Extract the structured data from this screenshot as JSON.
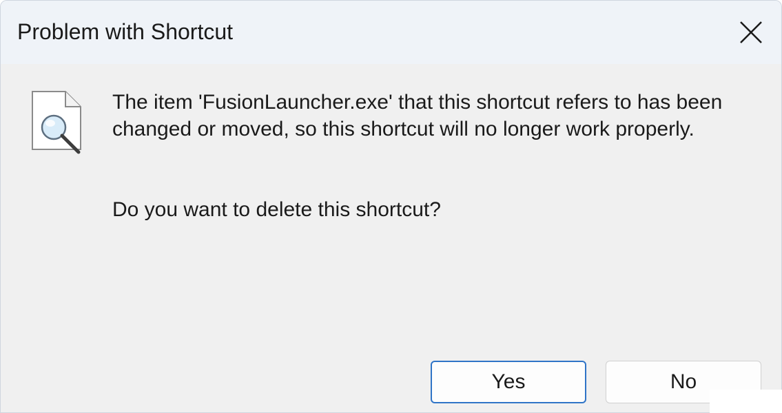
{
  "dialog": {
    "title": "Problem with Shortcut",
    "message": "The item 'FusionLauncher.exe' that this shortcut refers to has been changed or moved, so this shortcut will no longer work properly.",
    "question": "Do you want to delete this shortcut?",
    "buttons": {
      "yes_label": "Yes",
      "no_label": "No"
    },
    "icons": {
      "close": "close-icon",
      "content": "file-search-icon"
    },
    "colors": {
      "title_bar": "#eff3f8",
      "body": "#f0f0f0",
      "default_button_border": "#2f74c7"
    }
  }
}
